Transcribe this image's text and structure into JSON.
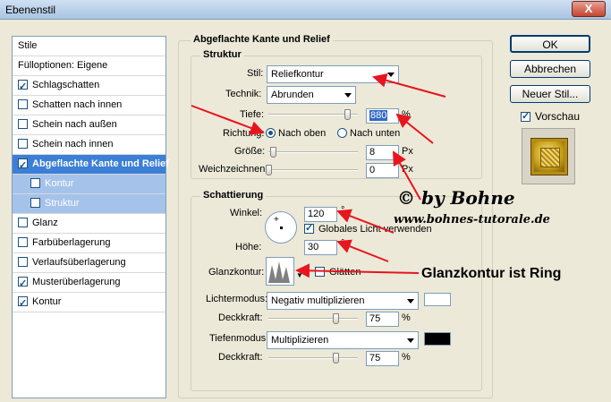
{
  "window": {
    "title": "Ebenenstil",
    "close_label": "X"
  },
  "stylelist": {
    "items": [
      {
        "label": "Stile",
        "checkbox": false,
        "checked": false,
        "state": "normal"
      },
      {
        "label": "Fülloptionen: Eigene",
        "checkbox": false,
        "checked": false,
        "state": "normal"
      },
      {
        "label": "Schlagschatten",
        "checkbox": true,
        "checked": true,
        "state": "normal"
      },
      {
        "label": "Schatten nach innen",
        "checkbox": true,
        "checked": false,
        "state": "normal"
      },
      {
        "label": "Schein nach außen",
        "checkbox": true,
        "checked": false,
        "state": "normal"
      },
      {
        "label": "Schein nach innen",
        "checkbox": true,
        "checked": false,
        "state": "normal"
      },
      {
        "label": "Abgeflachte Kante und Relief",
        "checkbox": true,
        "checked": true,
        "state": "selected"
      },
      {
        "label": "Kontur",
        "checkbox": true,
        "checked": false,
        "state": "sub"
      },
      {
        "label": "Struktur",
        "checkbox": true,
        "checked": false,
        "state": "sub"
      },
      {
        "label": "Glanz",
        "checkbox": true,
        "checked": false,
        "state": "normal"
      },
      {
        "label": "Farbüberlagerung",
        "checkbox": true,
        "checked": false,
        "state": "normal"
      },
      {
        "label": "Verlaufsüberlagerung",
        "checkbox": true,
        "checked": false,
        "state": "normal"
      },
      {
        "label": "Musterüberlagerung",
        "checkbox": true,
        "checked": true,
        "state": "normal"
      },
      {
        "label": "Kontur",
        "checkbox": true,
        "checked": true,
        "state": "normal"
      }
    ]
  },
  "bevel": {
    "title": "Abgeflachte Kante und Relief",
    "structure": {
      "title": "Struktur",
      "style_label": "Stil:",
      "style_value": "Reliefkontur",
      "technique_label": "Technik:",
      "technique_value": "Abrunden",
      "depth_label": "Tiefe:",
      "depth_value": "880",
      "depth_unit": "%",
      "depth_fraction": 0.88,
      "direction_label": "Richtung:",
      "direction_up": "Nach oben",
      "direction_down": "Nach unten",
      "size_label": "Größe:",
      "size_value": "8",
      "size_unit": "Px",
      "size_fraction": 0.05,
      "soften_label": "Weichzeichnen:",
      "soften_value": "0",
      "soften_unit": "Px",
      "soften_fraction": 0.0
    },
    "shading": {
      "title": "Schattierung",
      "angle_label": "Winkel:",
      "angle_value": "120",
      "angle_unit": "°",
      "global_light_label": "Globales Licht verwenden",
      "global_light_checked": true,
      "altitude_label": "Höhe:",
      "altitude_value": "30",
      "altitude_unit": "°",
      "gloss_label": "Glanzkontur:",
      "antialias_label": "Glätten",
      "antialias_checked": false,
      "highlight_mode_label": "Lichtermodus:",
      "highlight_mode_value": "Negativ multiplizieren",
      "highlight_color": "#ffffff",
      "highlight_opacity_label": "Deckkraft:",
      "highlight_opacity_value": "75",
      "highlight_opacity_unit": "%",
      "highlight_opacity_fraction": 0.75,
      "shadow_mode_label": "Tiefenmodus:",
      "shadow_mode_value": "Multiplizieren",
      "shadow_color": "#000000",
      "shadow_opacity_label": "Deckkraft:",
      "shadow_opacity_value": "75",
      "shadow_opacity_unit": "%",
      "shadow_opacity_fraction": 0.75
    }
  },
  "buttons": {
    "ok": "OK",
    "cancel": "Abbrechen",
    "new_style": "Neuer Stil...",
    "preview": "Vorschau",
    "preview_checked": true
  },
  "overlay": {
    "copyright": "© by Bohne",
    "website": "www.bohnes-tutorale.de",
    "annotation": "Glanzkontur ist Ring",
    "arrow_color": "#e8141e"
  }
}
